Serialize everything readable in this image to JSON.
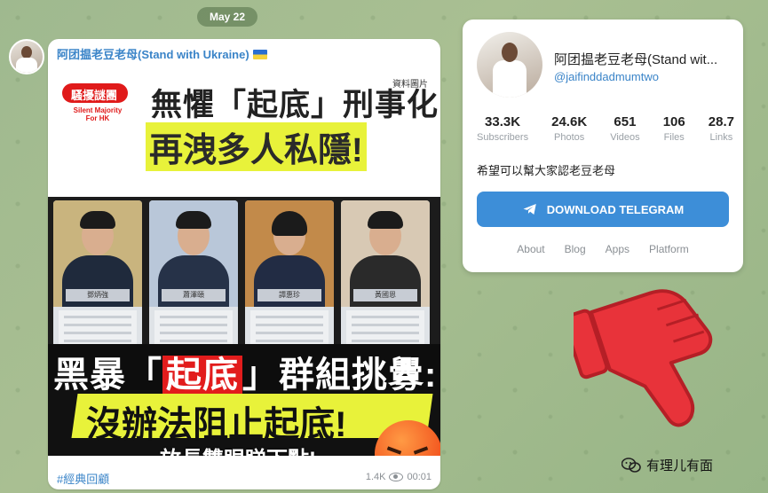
{
  "date_label": "May 22",
  "message": {
    "sender": "阿团揾老豆老母(Stand with Ukraine)",
    "hashtag": "#經典回顧",
    "views": "1.4K",
    "time": "00:01",
    "poster": {
      "logo_text": "騷擾謎團",
      "logo_sub": "Silent Majority For HK",
      "source_tag": "資料圖片",
      "headline_1": "無懼「起底」刑事化",
      "headline_2": "再洩多人私隱!",
      "people": [
        "鄧炳強",
        "蕭澤頤",
        "譚惠珍",
        "黃國恩"
      ],
      "band_1_pre": "黑暴「",
      "band_1_key": "起底",
      "band_1_post": "」群組挑釁:",
      "band_2": "沒辦法阻止起底!",
      "band_3": "放長雙眼睇下點!"
    }
  },
  "channel": {
    "name": "阿团揾老豆老母(Stand wit...",
    "handle": "@jaifinddadmumtwo",
    "stats": [
      {
        "value": "33.3K",
        "label": "Subscribers"
      },
      {
        "value": "24.6K",
        "label": "Photos"
      },
      {
        "value": "651",
        "label": "Videos"
      },
      {
        "value": "106",
        "label": "Files"
      },
      {
        "value": "28.7",
        "label": "Links"
      }
    ],
    "description": "希望可以幫大家認老豆老母",
    "download_label": "DOWNLOAD TELEGRAM",
    "links": [
      "About",
      "Blog",
      "Apps",
      "Platform"
    ]
  },
  "watermark": "有理儿有面",
  "colors": {
    "accent": "#3d8ed8",
    "thumb_red": "#e8333a",
    "poster_yellow": "#e8f23a"
  }
}
